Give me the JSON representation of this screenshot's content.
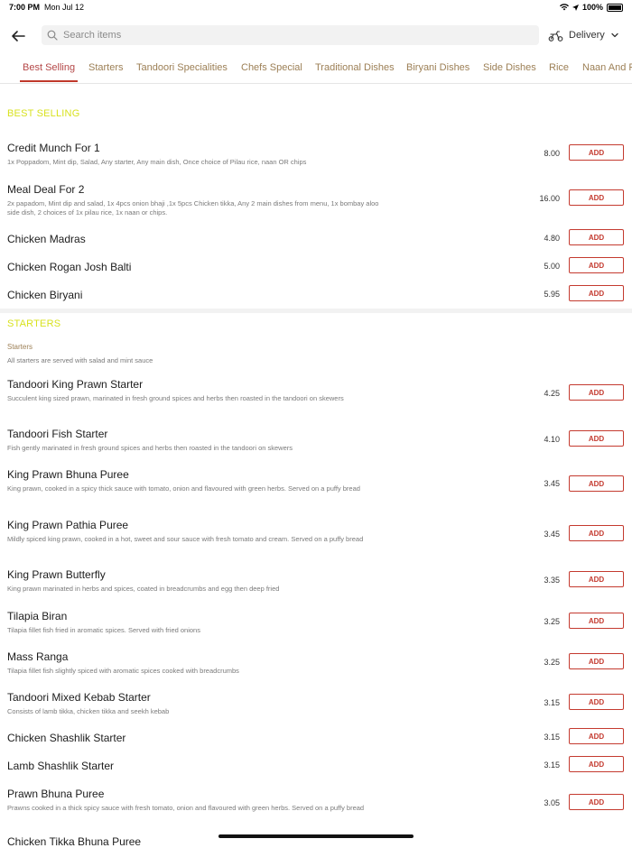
{
  "status": {
    "time": "7:00 PM",
    "date": "Mon Jul 12",
    "battery": "100%"
  },
  "search": {
    "placeholder": "Search items"
  },
  "delivery": {
    "label": "Delivery"
  },
  "tabs": [
    {
      "label": "Best Selling"
    },
    {
      "label": "Starters"
    },
    {
      "label": "Tandoori Specialities"
    },
    {
      "label": "Chefs Special"
    },
    {
      "label": "Traditional Dishes"
    },
    {
      "label": "Biryani Dishes"
    },
    {
      "label": "Side Dishes"
    },
    {
      "label": "Rice"
    },
    {
      "label": "Naan And R"
    }
  ],
  "best_selling": {
    "title": "BEST SELLING",
    "items": [
      {
        "name": "Credit Munch For 1",
        "desc": "1x Poppadom, Mint dip, Salad, Any starter, Any main dish, Once choice of Pilau rice, naan OR chips",
        "price": "8.00",
        "add": "ADD"
      },
      {
        "name": "Meal Deal For 2",
        "desc": "2x papadom, Mint dip and salad, 1x 4pcs onion bhaji ,1x 5pcs Chicken tikka, Any 2 main dishes from menu, 1x bombay aloo side dish, 2 choices of 1x pilau rice, 1x naan or chips.",
        "price": "16.00",
        "add": "ADD"
      },
      {
        "name": "Chicken Madras",
        "desc": "",
        "price": "4.80",
        "add": "ADD"
      },
      {
        "name": "Chicken Rogan Josh Balti",
        "desc": "",
        "price": "5.00",
        "add": "ADD"
      },
      {
        "name": "Chicken Biryani",
        "desc": "",
        "price": "5.95",
        "add": "ADD"
      }
    ]
  },
  "starters": {
    "title": "STARTERS",
    "subtitle": "Starters",
    "note": "All starters are served with salad and mint sauce",
    "items": [
      {
        "name": "Tandoori King Prawn Starter",
        "desc": "Succulent king sized prawn, marinated in fresh ground spices and herbs then roasted in the tandoori on skewers",
        "price": "4.25",
        "add": "ADD"
      },
      {
        "name": "Tandoori Fish Starter",
        "desc": "Fish gently marinated in fresh ground spices and herbs then roasted in the tandoori on skewers",
        "price": "4.10",
        "add": "ADD"
      },
      {
        "name": "King Prawn Bhuna Puree",
        "desc": "King prawn, cooked in a spicy thick sauce with tomato, onion and flavoured with green herbs. Served on a puffy bread",
        "price": "3.45",
        "add": "ADD"
      },
      {
        "name": "King Prawn Pathia Puree",
        "desc": "Mildly spiced king prawn, cooked in a hot, sweet and sour sauce with fresh tomato and cream. Served on a puffy bread",
        "price": "3.45",
        "add": "ADD"
      },
      {
        "name": "King Prawn Butterfly",
        "desc": "King prawn marinated in herbs and spices, coated in breadcrumbs and egg then deep fried",
        "price": "3.35",
        "add": "ADD"
      },
      {
        "name": "Tilapia Biran",
        "desc": "Tilapia fillet fish fried in aromatic spices. Served with fried onions",
        "price": "3.25",
        "add": "ADD"
      },
      {
        "name": "Mass Ranga",
        "desc": "Tilapia fillet fish slightly spiced with aromatic spices cooked with breadcrumbs",
        "price": "3.25",
        "add": "ADD"
      },
      {
        "name": "Tandoori Mixed Kebab Starter",
        "desc": "Consists of lamb tikka, chicken tikka and seekh kebab",
        "price": "3.15",
        "add": "ADD"
      },
      {
        "name": "Chicken Shashlik Starter",
        "desc": "",
        "price": "3.15",
        "add": "ADD"
      },
      {
        "name": "Lamb Shashlik Starter",
        "desc": "",
        "price": "3.15",
        "add": "ADD"
      },
      {
        "name": "Prawn Bhuna Puree",
        "desc": "Prawns cooked in a thick spicy sauce with fresh tomato, onion and flavoured with green herbs. Served on a puffy bread",
        "price": "3.05",
        "add": "ADD"
      },
      {
        "name": "Chicken Tikka Bhuna Puree",
        "desc": "",
        "price": "",
        "add": ""
      }
    ]
  },
  "colors": {
    "accent": "#c43a2f",
    "section_title": "#d8e21f",
    "tab_text": "#9c7f55"
  }
}
